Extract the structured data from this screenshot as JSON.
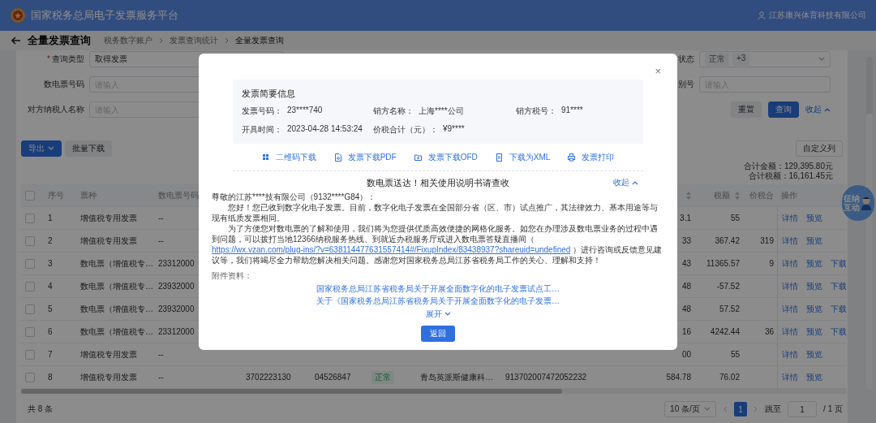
{
  "header": {
    "title": "国家税务总局电子发票服务平台",
    "user": "江苏康兴体育科技有限公司"
  },
  "page": {
    "title": "全量发票查询",
    "breadcrumb": [
      "税务数字账户",
      "发票查询统计",
      "全量发票查询"
    ]
  },
  "filters": {
    "left": [
      {
        "marker": "*",
        "label": "查询类型",
        "kind": "select",
        "value": "取得发票"
      },
      {
        "label": "数电票号码",
        "kind": "input",
        "placeholder": "请输入"
      },
      {
        "label": "对方纳税人名称",
        "kind": "input",
        "placeholder": "请输入"
      }
    ],
    "right": [
      {
        "label": "状态",
        "kind": "tags",
        "tags": [
          "正常",
          "+3"
        ]
      },
      {
        "label": "别号",
        "kind": "input",
        "placeholder": "请输入"
      }
    ],
    "reset": "重置",
    "query": "查询",
    "collapse": "收起"
  },
  "toolbar": {
    "export": "导出",
    "batch_download": "批量下载",
    "customize": "自定义列"
  },
  "summary": [
    "合计金额：129,395.80元",
    "合计税额：16,161.45元"
  ],
  "table": {
    "all_checked": false,
    "columns": [
      {
        "label": "序号",
        "sortable": false
      },
      {
        "label": "票种",
        "sortable": false
      },
      {
        "label": "数电票号码",
        "sortable": false
      },
      {
        "sortable": true
      },
      {
        "label": "税额",
        "sortable": true
      },
      {
        "label": "价税合",
        "sortable": false
      },
      {
        "label": "操作",
        "sortable": false
      }
    ],
    "rows": [
      {
        "checked": false,
        "seq": "1",
        "type": "增值税专用发票",
        "number": "--",
        "amount": "3.1",
        "tax": "55",
        "actions": [
          "详情",
          "预览"
        ]
      },
      {
        "checked": false,
        "seq": "2",
        "type": "增值税专用发票",
        "number": "--",
        "amount": "33",
        "tax": "367.42",
        "total": "319",
        "actions": [
          "详情",
          "预览"
        ]
      },
      {
        "checked": false,
        "seq": "3",
        "type": "数电票（增值税专…",
        "number": "23312000",
        "amount": "43",
        "tax": "11365.57",
        "total": "9",
        "actions": [
          "详情",
          "预览",
          "下载"
        ]
      },
      {
        "checked": false,
        "seq": "4",
        "type": "数电票（增值税专…",
        "number": "23932000",
        "amount": "48",
        "tax": "-57.52",
        "actions": [
          "详情",
          "预览",
          "下载"
        ]
      },
      {
        "checked": false,
        "seq": "5",
        "type": "数电票（增值税专…",
        "number": "23932000",
        "amount": "48",
        "tax": "57.52",
        "actions": [
          "详情",
          "预览",
          "下载"
        ]
      },
      {
        "checked": false,
        "seq": "6",
        "type": "数电票（增值税专…",
        "number": "23312000",
        "amount": "16",
        "tax": "4242.44",
        "total": "36",
        "actions": [
          "详情",
          "预览",
          "下载"
        ]
      },
      {
        "checked": false,
        "seq": "7",
        "type": "增值税专用发票",
        "number": "--",
        "amount": "00",
        "tax": "55",
        "actions": [
          "详情",
          "预览"
        ]
      },
      {
        "checked": false,
        "seq": "8",
        "type": "增值税专用发票",
        "number": "--",
        "code": "3702223130",
        "invoice_no": "04526847",
        "status": "正常",
        "seller": "青岛英派斯健康科…",
        "seller_tax_id": "913702007472052232",
        "amount": "584.78",
        "tax": "76.02",
        "actions": [
          "详情",
          "预览"
        ]
      }
    ]
  },
  "pagination": {
    "total": "共 8 条",
    "page_size": "10 条/页",
    "pages": [
      {
        "label": "1",
        "selected": true
      }
    ],
    "jump_label": "跳至",
    "jump_value": "1",
    "page_count": "/ 1 页"
  },
  "assistant": {
    "label": "征纳互动"
  },
  "modal": {
    "close": "×",
    "info_title": "发票简要信息",
    "fields": [
      {
        "label": "发票号码：",
        "value": "23****740"
      },
      {
        "label": "销方名称：",
        "value": "上海****公司"
      },
      {
        "label": "销方税号：",
        "value": "91****"
      },
      {
        "label": "开具时间：",
        "value": "2023-04-28 14:53:24"
      },
      {
        "label": "价税合计（元）：",
        "value": "¥9****"
      }
    ],
    "actions": [
      {
        "kind": "qr",
        "label": "二维码下载"
      },
      {
        "kind": "pdf",
        "label": "发票下载PDF"
      },
      {
        "kind": "ofd",
        "label": "发票下载OFD"
      },
      {
        "kind": "xml",
        "label": "下载为XML"
      },
      {
        "kind": "print",
        "label": "发票打印"
      }
    ],
    "notice": {
      "title": "数电票送达！相关使用说明书请查收",
      "collapse": "收起",
      "greeting": "尊敬的江苏****技有限公司（9132****G84）：",
      "paragraph_1": "您好！您已收到数字化电子发票。目前，数字化电子发票在全国部分省（区、市）试点推广，其法律效力、基本用途等与现有纸质发票相同。",
      "paragraph_2": {
        "before": "为了方便您对数电票的了解和使用，我们将为您提供优质高效便捷的网格化服务。如您在办理涉及数电票业务的过程中遇到问题，可以拨打当地12366纳税服务热线、到就近办税服务厅或进入数电票答疑直播间（ ",
        "link": "https://wx.vzan.com/plug-ins/?v=638114477631557414#/FixupIndex/83438937?shareuid=undefined",
        "after": " ）进行咨询或反馈意见建议等，我们将竭尽全力帮助您解决相关问题。感谢您对国家税务总局江苏省税务局工作的关心、理解和支持！"
      }
    },
    "attachments_label": "附件资料：",
    "attachments": [
      "国家税务总局江苏省税务局关于开展全面数字化的电子发票试点工…",
      "关于《国家税务总局江苏省税务局关于开展全面数字化的电子发票…"
    ],
    "expand": "展开",
    "back": "返回"
  }
}
